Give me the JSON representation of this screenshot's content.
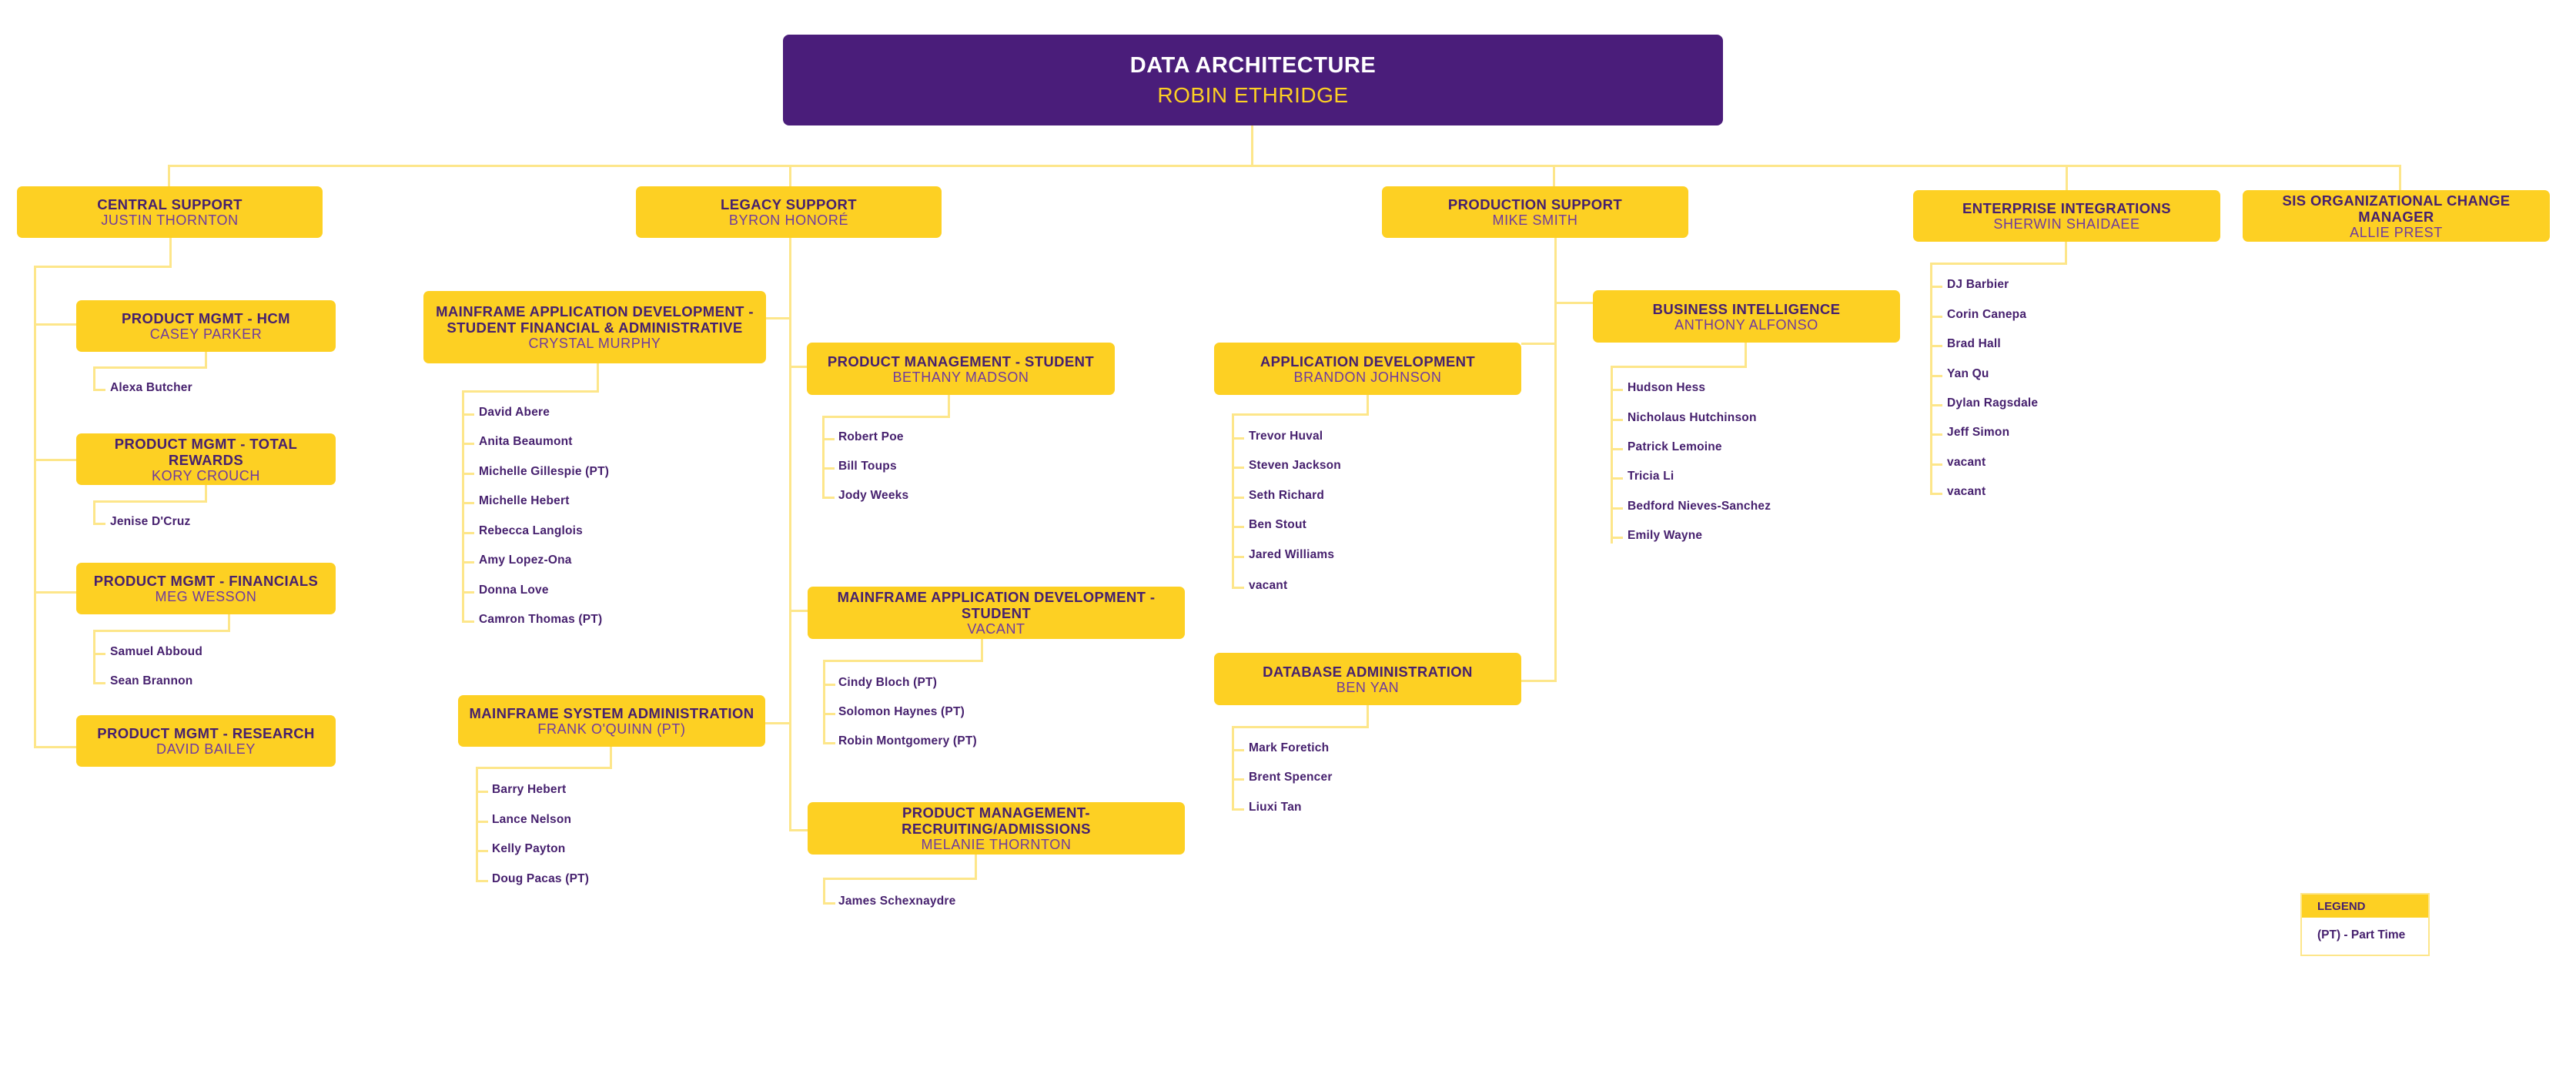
{
  "root": {
    "title": "DATA ARCHITECTURE",
    "name": "ROBIN ETHRIDGE"
  },
  "colors": {
    "root_bg": "#4a1d7a",
    "box_bg": "#fdd023",
    "title_text": "#46206e",
    "name_text": "#6f3a9e",
    "connector": "#fde68a"
  },
  "central_support": {
    "title": "CENTRAL SUPPORT",
    "name": "JUSTIN THORNTON",
    "teams": [
      {
        "title": "PRODUCT MGMT - HCM",
        "name": "CASEY PARKER",
        "members": [
          "Alexa Butcher"
        ]
      },
      {
        "title": "PRODUCT MGMT - TOTAL REWARDS",
        "name": "KORY CROUCH",
        "members": [
          "Jenise D'Cruz"
        ]
      },
      {
        "title": "PRODUCT MGMT - FINANCIALS",
        "name": "MEG WESSON",
        "members": [
          "Samuel Abboud",
          "Sean Brannon"
        ]
      },
      {
        "title": "PRODUCT MGMT - RESEARCH",
        "name": "DAVID BAILEY",
        "members": []
      }
    ]
  },
  "legacy_support": {
    "title": "LEGACY SUPPORT",
    "name": "BYRON HONORÉ",
    "teams": [
      {
        "title_line1": "MAINFRAME APPLICATION  DEVELOPMENT -",
        "title_line2": "STUDENT FINANCIAL & ADMINISTRATIVE",
        "name": "CRYSTAL MURPHY",
        "members": [
          "David Abere",
          "Anita Beaumont",
          "Michelle Gillespie (PT)",
          "Michelle Hebert",
          "Rebecca Langlois",
          "Amy Lopez-Ona",
          "Donna Love",
          "Camron Thomas (PT)"
        ]
      },
      {
        "title": "MAINFRAME SYSTEM ADMINISTRATION",
        "name": "FRANK O'QUINN (PT)",
        "members": [
          "Barry Hebert",
          "Lance Nelson",
          "Kelly Payton",
          "Doug Pacas (PT)"
        ]
      },
      {
        "title": "PRODUCT MANAGEMENT - STUDENT",
        "name": "BETHANY MADSON",
        "members": [
          "Robert Poe",
          "Bill Toups",
          "Jody Weeks"
        ]
      },
      {
        "title": "MAINFRAME APPLICATION DEVELOPMENT - STUDENT",
        "name": "VACANT",
        "members": [
          "Cindy Bloch (PT)",
          "Solomon Haynes (PT)",
          "Robin Montgomery (PT)"
        ]
      },
      {
        "title": "PRODUCT MANAGEMENT- RECRUITING/ADMISSIONS",
        "name": "MELANIE THORNTON",
        "members": [
          "James Schexnaydre"
        ]
      }
    ]
  },
  "production_support": {
    "title": "PRODUCTION SUPPORT",
    "name": "MIKE SMITH",
    "teams": [
      {
        "title": "APPLICATION DEVELOPMENT",
        "name": "BRANDON JOHNSON",
        "members": [
          "Trevor Huval",
          "Steven Jackson",
          "Seth Richard",
          "Ben Stout",
          "Jared Williams",
          "vacant"
        ]
      },
      {
        "title": "DATABASE ADMINISTRATION",
        "name": "BEN YAN",
        "members": [
          "Mark Foretich",
          "Brent Spencer",
          "Liuxi Tan"
        ]
      },
      {
        "title": "BUSINESS INTELLIGENCE",
        "name": "ANTHONY ALFONSO",
        "members": [
          "Hudson Hess",
          "Nicholaus Hutchinson",
          "Patrick Lemoine",
          "Tricia Li",
          "Bedford Nieves-Sanchez",
          "Emily Wayne"
        ]
      }
    ]
  },
  "enterprise_integrations": {
    "title": "ENTERPRISE INTEGRATIONS",
    "name": "SHERWIN SHAIDAEE",
    "members": [
      "DJ Barbier",
      "Corin Canepa",
      "Brad Hall",
      "Yan Qu",
      "Dylan Ragsdale",
      "Jeff Simon",
      "vacant",
      "vacant"
    ]
  },
  "sis_change": {
    "title": "SIS ORGANIZATIONAL CHANGE MANAGER",
    "name": "ALLIE PREST"
  },
  "legend": {
    "title": "LEGEND",
    "entry": "(PT) - Part Time"
  }
}
